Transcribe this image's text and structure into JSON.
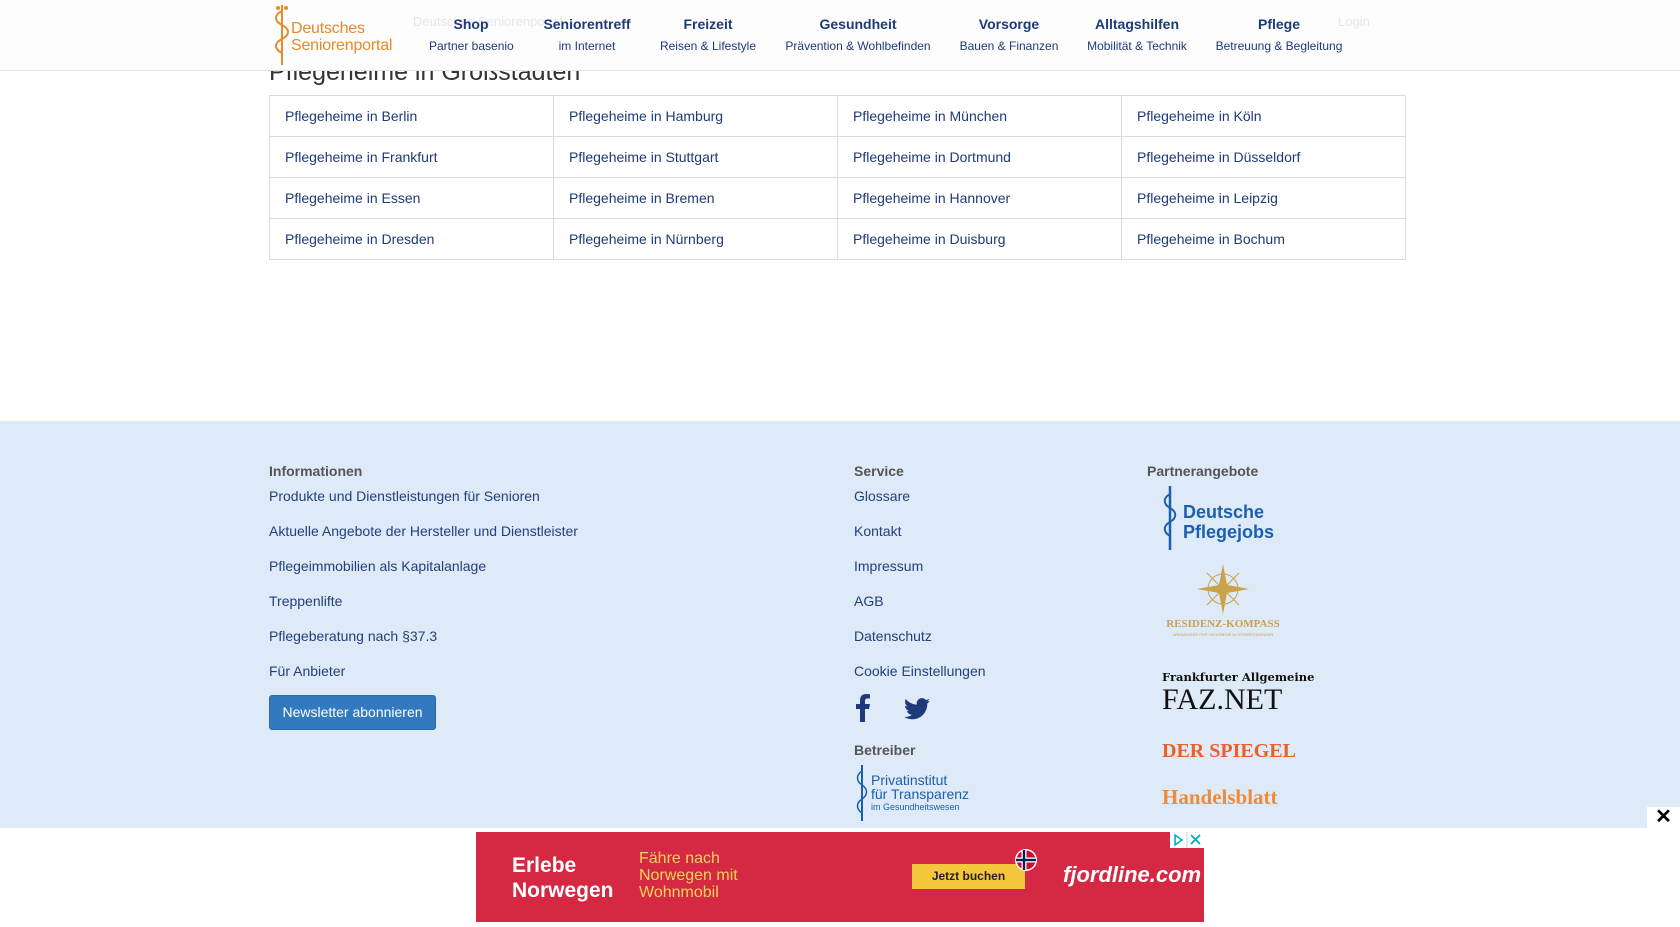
{
  "header": {
    "logo_line1": "Deutsches",
    "logo_line2": "Seniorenportal",
    "ghost_left": "Deutsches Seniorenportal",
    "ghost_right": "Login",
    "nav": [
      {
        "title": "Shop",
        "sub": "Partner basenio"
      },
      {
        "title": "Seniorentreff",
        "sub": "im Internet"
      },
      {
        "title": "Freizeit",
        "sub": "Reisen & Lifestyle"
      },
      {
        "title": "Gesundheit",
        "sub": "Prävention & Wohlbefinden"
      },
      {
        "title": "Vorsorge",
        "sub": "Bauen & Finanzen"
      },
      {
        "title": "Alltagshilfen",
        "sub": "Mobilität & Technik"
      },
      {
        "title": "Pflege",
        "sub": "Betreuung & Begleitung"
      }
    ]
  },
  "section_title": "Pflegeheime in Großstädten",
  "cities": [
    [
      "Pflegeheime in Berlin",
      "Pflegeheime in Hamburg",
      "Pflegeheime in München",
      "Pflegeheime in Köln"
    ],
    [
      "Pflegeheime in Frankfurt",
      "Pflegeheime in Stuttgart",
      "Pflegeheime in Dortmund",
      "Pflegeheime in Düsseldorf"
    ],
    [
      "Pflegeheime in Essen",
      "Pflegeheime in Bremen",
      "Pflegeheime in Hannover",
      "Pflegeheime in Leipzig"
    ],
    [
      "Pflegeheime in Dresden",
      "Pflegeheime in Nürnberg",
      "Pflegeheime in Duisburg",
      "Pflegeheime in Bochum"
    ]
  ],
  "footer": {
    "info_title": "Informationen",
    "info_links": [
      "Produkte und Dienstleistungen für Senioren",
      "Aktuelle Angebote der Hersteller und Dienstleister",
      "Pflegeimmobilien als Kapitalanlage",
      "Treppenlifte",
      "Pflegeberatung nach §37.3",
      "Für Anbieter"
    ],
    "newsletter_label": "Newsletter abonnieren",
    "service_title": "Service",
    "service_links": [
      "Glossare",
      "Kontakt",
      "Impressum",
      "AGB",
      "Datenschutz",
      "Cookie Einstellungen"
    ],
    "betreiber_title": "Betreiber",
    "betreiber_logo": {
      "line1": "Privatinstitut",
      "line2": "für Transparenz",
      "line3": "im Gesundheitswesen"
    },
    "partner_title": "Partnerangebote",
    "partners": {
      "pflegejobs_1": "Deutsche",
      "pflegejobs_2": "Pflegejobs",
      "residenz": "RESIDENZ-KOMPASS",
      "residenz_sub": "WEGWEISER FÜR GEHOBENE ALTERSRESIDENZEN",
      "faz_top": "Frankfurter Allgemeine",
      "faz_bottom": "FAZ.NET",
      "spiegel": "DER SPIEGEL",
      "handelsblatt": "Handelsblatt"
    },
    "colors": {
      "background": "#deeaf8",
      "link": "#23407a",
      "button": "#3279c0"
    }
  },
  "ad": {
    "headline_1": "Erlebe",
    "headline_2": "Norwegen",
    "sub_1": "Fähre nach",
    "sub_2": "Norwegen mit",
    "sub_3": "Wohnmobil",
    "button": "Jetzt buchen",
    "brand": "fjordline.com",
    "close": "✕"
  }
}
